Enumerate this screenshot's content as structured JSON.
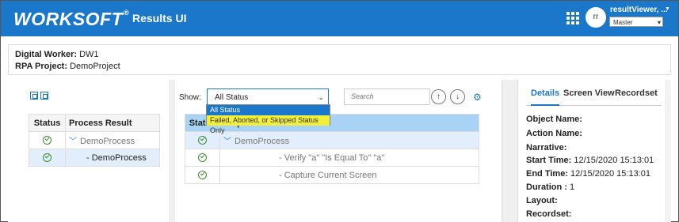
{
  "header": {
    "logo": "WORKSOFT",
    "logo_mark": "®",
    "app_title": "Results UI",
    "avatar_initials": "rr",
    "user_name": "resultViewer, ...",
    "environment": "Master"
  },
  "info": {
    "digital_worker_label": "Digital Worker:",
    "digital_worker_value": "DW1",
    "rpa_project_label": "RPA Project:",
    "rpa_project_value": "DemoProject"
  },
  "left_table": {
    "headers": [
      "Status",
      "Process Result"
    ],
    "rows": [
      {
        "name": "DemoProcess"
      },
      {
        "name": "DemoProcess"
      }
    ]
  },
  "filter": {
    "show_label": "Show:",
    "selected": "All Status",
    "options": [
      "All Status",
      "Failed, Aborted, or Skipped Status Only"
    ]
  },
  "search": {
    "placeholder": "Search"
  },
  "right_table": {
    "headers": [
      "Status",
      "Steps/Narrative"
    ],
    "rows": [
      {
        "text": "DemoProcess"
      },
      {
        "text": "Verify \"a\" \"Is Equal To\" \"a\""
      },
      {
        "text": "Capture Current Screen"
      }
    ]
  },
  "details": {
    "tabs": [
      "Details",
      "Screen View",
      "Recordset"
    ],
    "fields": [
      {
        "label": "Object Name:",
        "value": ""
      },
      {
        "label": "Action Name:",
        "value": ""
      },
      {
        "label": "Narrative:",
        "value": ""
      },
      {
        "label": "Start Time:",
        "value": "12/15/2020 15:13:01"
      },
      {
        "label": "End Time:",
        "value": "12/15/2020 15:13:01"
      },
      {
        "label": "Duration :",
        "value": "1"
      },
      {
        "label": "Layout:",
        "value": ""
      },
      {
        "label": "Recordset:",
        "value": ""
      }
    ]
  },
  "colors": {
    "header_bg": "#1a77c9",
    "highlight": "#f2ef3a",
    "success": "#3a8a2a"
  }
}
